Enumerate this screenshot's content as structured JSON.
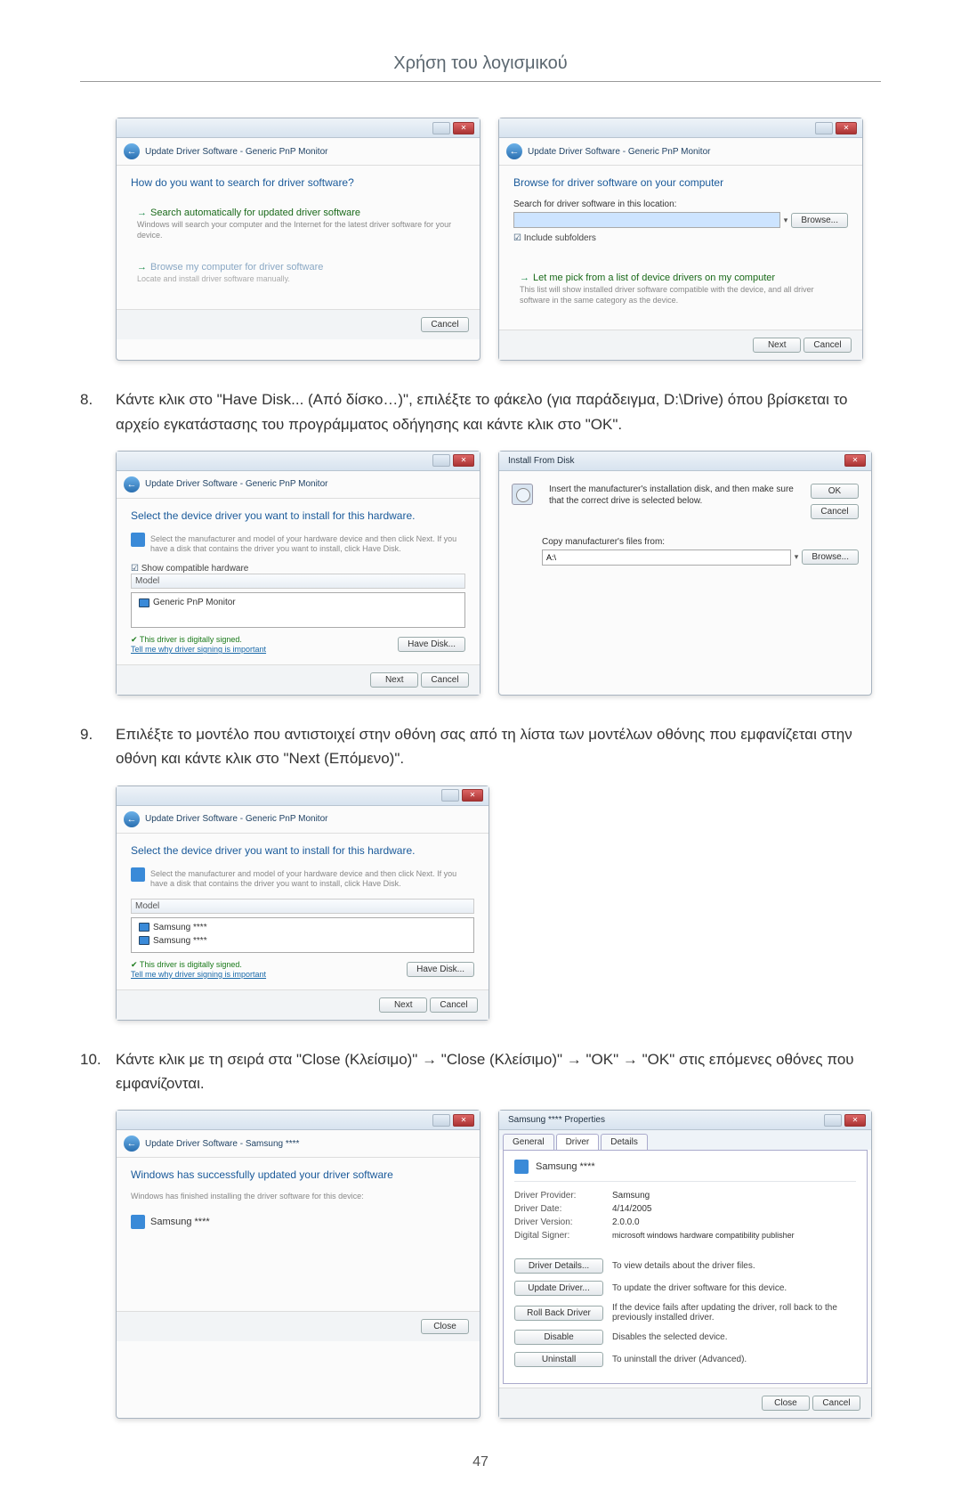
{
  "header_title": "Χρήση του λογισμικού",
  "page_number": "47",
  "steps": {
    "s8": {
      "num": "8.",
      "text": "Κάντε κλικ στο \"Have Disk... (Από δίσκο…)\", επιλέξτε το φάκελο (για παράδειγμα, D:\\Drive) όπου βρίσκεται το αρχείο εγκατάστασης του προγράμματος οδήγησης και κάντε κλικ στο \"OK\"."
    },
    "s9": {
      "num": "9.",
      "text": "Επιλέξτε το μοντέλο που αντιστοιχεί στην οθόνη σας από τη λίστα των μοντέλων οθόνης που εμφανίζεται στην οθόνη και κάντε κλικ στο \"Next (Επόμενο)\"."
    },
    "s10": {
      "num": "10.",
      "text": "Κάντε κλικ με τη σειρά στα \"Close (Κλείσιμο)\" → \"Close (Κλείσιμο)\" → \"OK\" → \"OK\" στις επόμενες οθόνες που εμφανίζονται."
    }
  },
  "win1": {
    "breadcrumb": "Update Driver Software - Generic PnP Monitor",
    "prompt": "How do you want to search for driver software?",
    "opt1_title": "Search automatically for updated driver software",
    "opt1_sub": "Windows will search your computer and the Internet for the latest driver software for your device.",
    "opt2_title": "Browse my computer for driver software",
    "opt2_sub": "Locate and install driver software manually.",
    "cancel": "Cancel"
  },
  "win2": {
    "breadcrumb": "Update Driver Software - Generic PnP Monitor",
    "prompt": "Browse for driver software on your computer",
    "label": "Search for driver software in this location:",
    "browse": "Browse...",
    "chk": "Include subfolders",
    "opt_title": "Let me pick from a list of device drivers on my computer",
    "opt_sub": "This list will show installed driver software compatible with the device, and all driver software in the same category as the device.",
    "next": "Next",
    "cancel": "Cancel"
  },
  "win3": {
    "breadcrumb": "Update Driver Software - Generic PnP Monitor",
    "prompt": "Select the device driver you want to install for this hardware.",
    "sub": "Select the manufacturer and model of your hardware device and then click Next. If you have a disk that contains the driver you want to install, click Have Disk.",
    "chk": "Show compatible hardware",
    "col": "Model",
    "row": "Generic PnP Monitor",
    "signed": "This driver is digitally signed.",
    "why": "Tell me why driver signing is important",
    "have_disk": "Have Disk...",
    "next": "Next",
    "cancel": "Cancel"
  },
  "win4": {
    "title": "Install From Disk",
    "text": "Insert the manufacturer's installation disk, and then make sure that the correct drive is selected below.",
    "ok": "OK",
    "cancel": "Cancel",
    "copy_label": "Copy manufacturer's files from:",
    "browse": "Browse..."
  },
  "win5": {
    "breadcrumb": "Update Driver Software - Generic PnP Monitor",
    "prompt": "Select the device driver you want to install for this hardware.",
    "sub": "Select the manufacturer and model of your hardware device and then click Next. If you have a disk that contains the driver you want to install, click Have Disk.",
    "col": "Model",
    "row1": "Samsung ****",
    "row2": "Samsung ****",
    "signed": "This driver is digitally signed.",
    "why": "Tell me why driver signing is important",
    "have_disk": "Have Disk...",
    "next": "Next",
    "cancel": "Cancel"
  },
  "win6": {
    "breadcrumb": "Update Driver Software - Samsung ****",
    "prompt": "Windows has successfully updated your driver software",
    "sub": "Windows has finished installing the driver software for this device:",
    "device": "Samsung ****",
    "close": "Close"
  },
  "win7": {
    "title": "Samsung **** Properties",
    "tabs": {
      "general": "General",
      "driver": "Driver",
      "details": "Details"
    },
    "device": "Samsung ****",
    "rows": {
      "provider_l": "Driver Provider:",
      "provider_v": "Samsung",
      "date_l": "Driver Date:",
      "date_v": "4/14/2005",
      "version_l": "Driver Version:",
      "version_v": "2.0.0.0",
      "signer_l": "Digital Signer:",
      "signer_v": "microsoft windows hardware compatibility publisher"
    },
    "btns": {
      "details": "Driver Details...",
      "details_d": "To view details about the driver files.",
      "update": "Update Driver...",
      "update_d": "To update the driver software for this device.",
      "rollback": "Roll Back Driver",
      "rollback_d": "If the device fails after updating the driver, roll back to the previously installed driver.",
      "disable": "Disable",
      "disable_d": "Disables the selected device.",
      "uninstall": "Uninstall",
      "uninstall_d": "To uninstall the driver (Advanced)."
    },
    "close": "Close",
    "cancel": "Cancel"
  }
}
